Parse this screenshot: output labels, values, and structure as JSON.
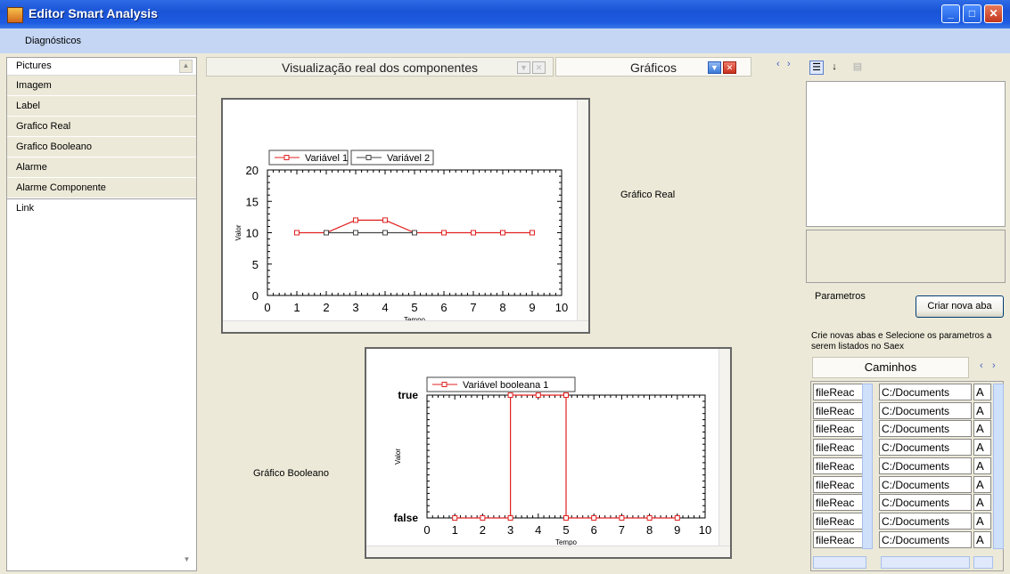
{
  "window": {
    "title": "Editor Smart Analysis"
  },
  "menu": {
    "items": [
      "Diagnósticos"
    ]
  },
  "left_panel": {
    "header": "Pictures",
    "items": [
      "Imagem",
      "Label",
      "Grafico Real",
      "Grafico Booleano",
      "Alarme",
      "Alarme Componente"
    ],
    "last_item": "Link"
  },
  "tabs": [
    {
      "label": "Visualização real dos componentes"
    },
    {
      "label": "Gráficos"
    }
  ],
  "charts": {
    "real": {
      "caption": "Gráfico Real",
      "legend": [
        "Variável 1",
        "Variável 2"
      ],
      "xlabel": "Tempo",
      "ylabel": "Valor",
      "x_ticks": [
        "0",
        "1",
        "2",
        "3",
        "4",
        "5",
        "6",
        "7",
        "8",
        "9",
        "10"
      ],
      "y_ticks": [
        "0",
        "5",
        "10",
        "15",
        "20"
      ]
    },
    "bool": {
      "caption": "Gráfico Booleano",
      "legend": [
        "Variável booleana 1"
      ],
      "xlabel": "Tempo",
      "ylabel": "Valor",
      "x_ticks": [
        "0",
        "1",
        "2",
        "3",
        "4",
        "5",
        "6",
        "7",
        "8",
        "9",
        "10"
      ],
      "y_ticks": [
        "false",
        "true"
      ]
    }
  },
  "chart_data": [
    {
      "type": "line",
      "xlabel": "Tempo",
      "ylabel": "Valor",
      "xlim": [
        0,
        10
      ],
      "ylim": [
        0,
        20
      ],
      "series": [
        {
          "name": "Variável 1",
          "color": "#e02020",
          "x": [
            1,
            2,
            3,
            4,
            5,
            6,
            7,
            8,
            9
          ],
          "values": [
            10,
            10,
            12,
            12,
            10,
            10,
            10,
            10,
            10
          ]
        },
        {
          "name": "Variável 2",
          "color": "#444444",
          "x": [
            2,
            3,
            4,
            5
          ],
          "values": [
            10,
            10,
            10,
            10
          ]
        }
      ]
    },
    {
      "type": "line",
      "xlabel": "Tempo",
      "ylabel": "Valor",
      "xlim": [
        0,
        10
      ],
      "ylim": [
        0,
        1
      ],
      "series": [
        {
          "name": "Variável booleana 1",
          "color": "#e02020",
          "x": [
            1,
            2,
            3,
            3,
            4,
            5,
            5,
            6,
            7,
            8,
            9
          ],
          "values": [
            0,
            0,
            0,
            1,
            1,
            1,
            0,
            0,
            0,
            0,
            0
          ]
        }
      ]
    }
  ],
  "properties": {
    "label": "Parametros",
    "button": "Criar nova aba",
    "hint": "Crie novas abas e Selecione os parametros a serem listados no Saex",
    "grid_header": "Caminhos",
    "rows": [
      {
        "col1": "fileReac",
        "col2": "C:/Documents",
        "col3": "A"
      },
      {
        "col1": "fileReac",
        "col2": "C:/Documents",
        "col3": "A"
      },
      {
        "col1": "fileReac",
        "col2": "C:/Documents",
        "col3": "A"
      },
      {
        "col1": "fileReac",
        "col2": "C:/Documents",
        "col3": "A"
      },
      {
        "col1": "fileReac",
        "col2": "C:/Documents",
        "col3": "A"
      },
      {
        "col1": "fileReac",
        "col2": "C:/Documents",
        "col3": "A"
      },
      {
        "col1": "fileReac",
        "col2": "C:/Documents",
        "col3": "A"
      },
      {
        "col1": "fileReac",
        "col2": "C:/Documents",
        "col3": "A"
      },
      {
        "col1": "fileReac",
        "col2": "C:/Documents",
        "col3": "A"
      }
    ]
  },
  "colors": {
    "title_bar": "#1a54d6",
    "series_red": "#e02020",
    "series_dark": "#444444"
  }
}
